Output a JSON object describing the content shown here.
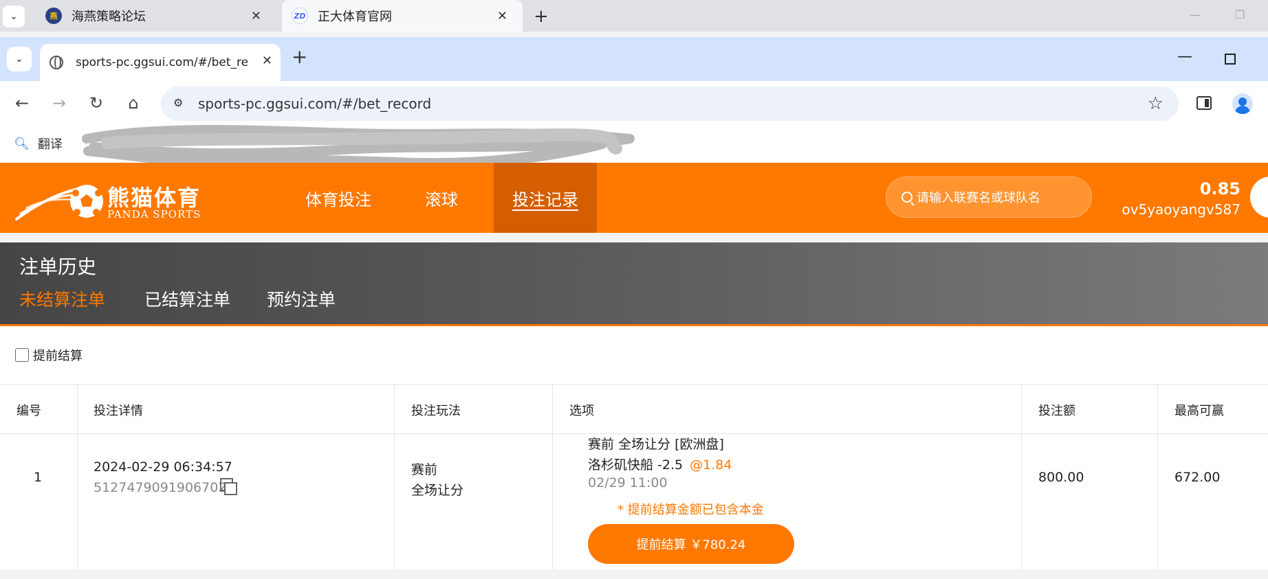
{
  "outer_browser": {
    "tabs": [
      {
        "title": "海燕策略论坛",
        "close": "✕"
      },
      {
        "title": "正大体育官网",
        "close": "✕"
      }
    ],
    "new_tab": "+",
    "window_controls": {
      "minimize": "—",
      "restore": "❐"
    }
  },
  "inner_browser": {
    "tab": {
      "title": "sports-pc.ggsui.com/#/bet_record",
      "close": "✕"
    },
    "new_tab": "+",
    "window_controls": {
      "minimize": "—"
    },
    "address": "sports-pc.ggsui.com/#/bet_record",
    "bookmark": "翻译"
  },
  "site": {
    "brand_cn": "熊猫体育",
    "brand_en": "PANDA SPORTS",
    "nav": [
      "体育投注",
      "滚球",
      "投注记录"
    ],
    "active_nav": "投注记录",
    "search_placeholder": "请输入联赛名或球队名",
    "balance": "0.85",
    "username": "ov5yaoyangv587",
    "brand_color": "#ff7800"
  },
  "history": {
    "title": "注单历史",
    "tabs": [
      "未结算注单",
      "已结算注单",
      "预约注单"
    ],
    "active_tab": "未结算注单"
  },
  "filter": {
    "label": "提前结算",
    "checked": false
  },
  "table": {
    "headers": [
      "编号",
      "投注详情",
      "投注玩法",
      "选项",
      "投注额",
      "最高可赢"
    ],
    "rows": [
      {
        "index": "1",
        "time": "2024-02-29 06:34:57",
        "order_id": "5127479091906702",
        "play_line1": "赛前",
        "play_line2": "全场让分",
        "option_market": "赛前 全场让分 [欧洲盘]",
        "option_pick": "洛杉矶快船 -2.5",
        "option_odds": "@1.84",
        "option_time": "02/29 11:00",
        "cashout_note": "* 提前结算金额已包含本金",
        "cashout_button": "提前结算 ￥780.24",
        "stake": "800.00",
        "max_win": "672.00"
      }
    ]
  }
}
